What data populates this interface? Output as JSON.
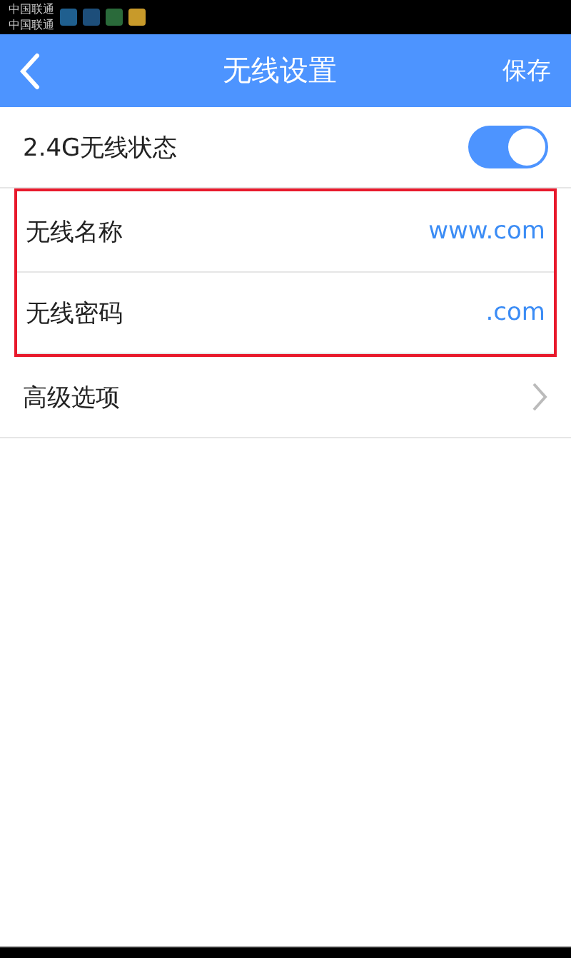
{
  "status_bar": {
    "carriers": [
      "中国联通",
      "中国联通"
    ]
  },
  "header": {
    "title": "无线设置",
    "action": "保存"
  },
  "rows": [
    {
      "kind": "toggle",
      "label": "2.4G无线状态",
      "on": true,
      "highlighted": false
    },
    {
      "kind": "value",
      "label": "无线名称",
      "value": "www.com",
      "highlighted": true
    },
    {
      "kind": "value",
      "label": "无线密码",
      "value": ".com",
      "highlighted": true
    },
    {
      "kind": "link",
      "label": "高级选项",
      "highlighted": false
    }
  ]
}
